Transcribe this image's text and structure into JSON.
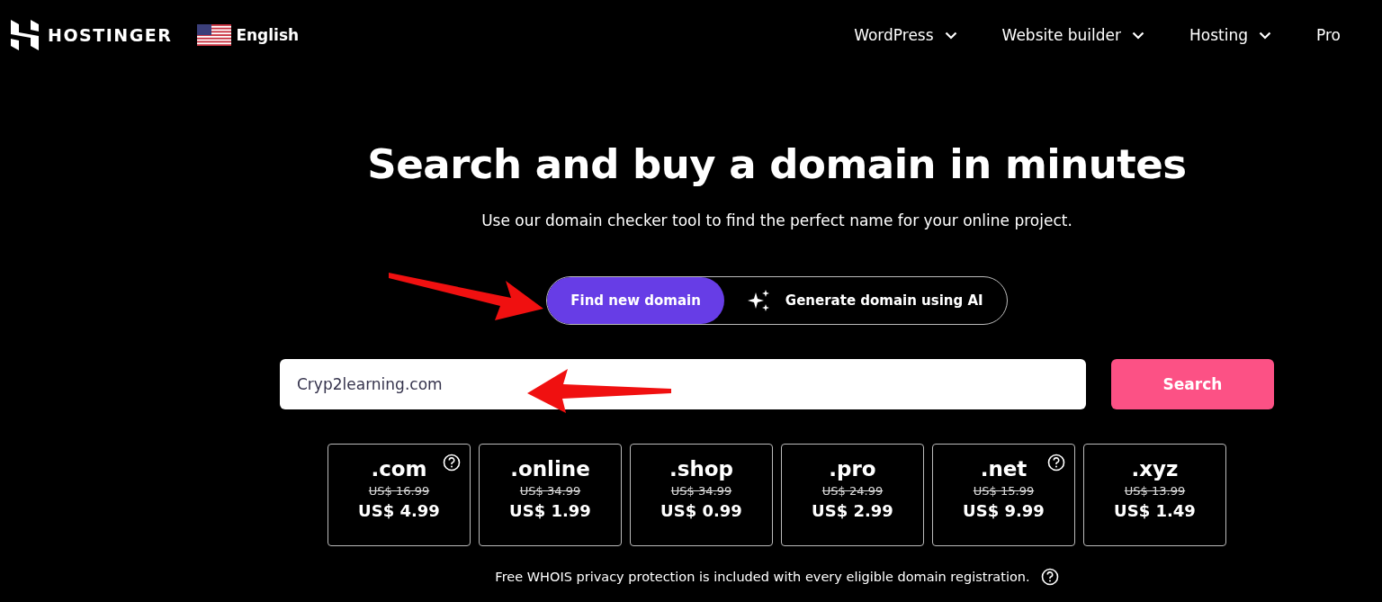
{
  "header": {
    "logo": "HOSTINGER",
    "language": "English",
    "nav": [
      {
        "label": "WordPress",
        "dropdown": true
      },
      {
        "label": "Website builder",
        "dropdown": true
      },
      {
        "label": "Hosting",
        "dropdown": true
      },
      {
        "label": "Pro",
        "dropdown": false
      }
    ]
  },
  "hero": {
    "title": "Search and buy a domain in minutes",
    "subtitle": "Use our domain checker tool to find the perfect name for your online project."
  },
  "tabs": [
    {
      "label": "Find new domain",
      "selected": true,
      "icon": false
    },
    {
      "label": "Generate domain using AI",
      "selected": false,
      "icon": true
    }
  ],
  "search": {
    "value": "Cryp2learning.com",
    "button": "Search"
  },
  "tlds": [
    {
      "name": ".com",
      "old_price": "US$ 16.99",
      "price": "US$ 4.99",
      "info": true
    },
    {
      "name": ".online",
      "old_price": "US$ 34.99",
      "price": "US$ 1.99",
      "info": false
    },
    {
      "name": ".shop",
      "old_price": "US$ 34.99",
      "price": "US$ 0.99",
      "info": false
    },
    {
      "name": ".pro",
      "old_price": "US$ 24.99",
      "price": "US$ 2.99",
      "info": false
    },
    {
      "name": ".net",
      "old_price": "US$ 15.99",
      "price": "US$ 9.99",
      "info": true
    },
    {
      "name": ".xyz",
      "old_price": "US$ 13.99",
      "price": "US$ 1.49",
      "info": false
    }
  ],
  "note": "Free WHOIS privacy protection is included with every eligible domain registration."
}
